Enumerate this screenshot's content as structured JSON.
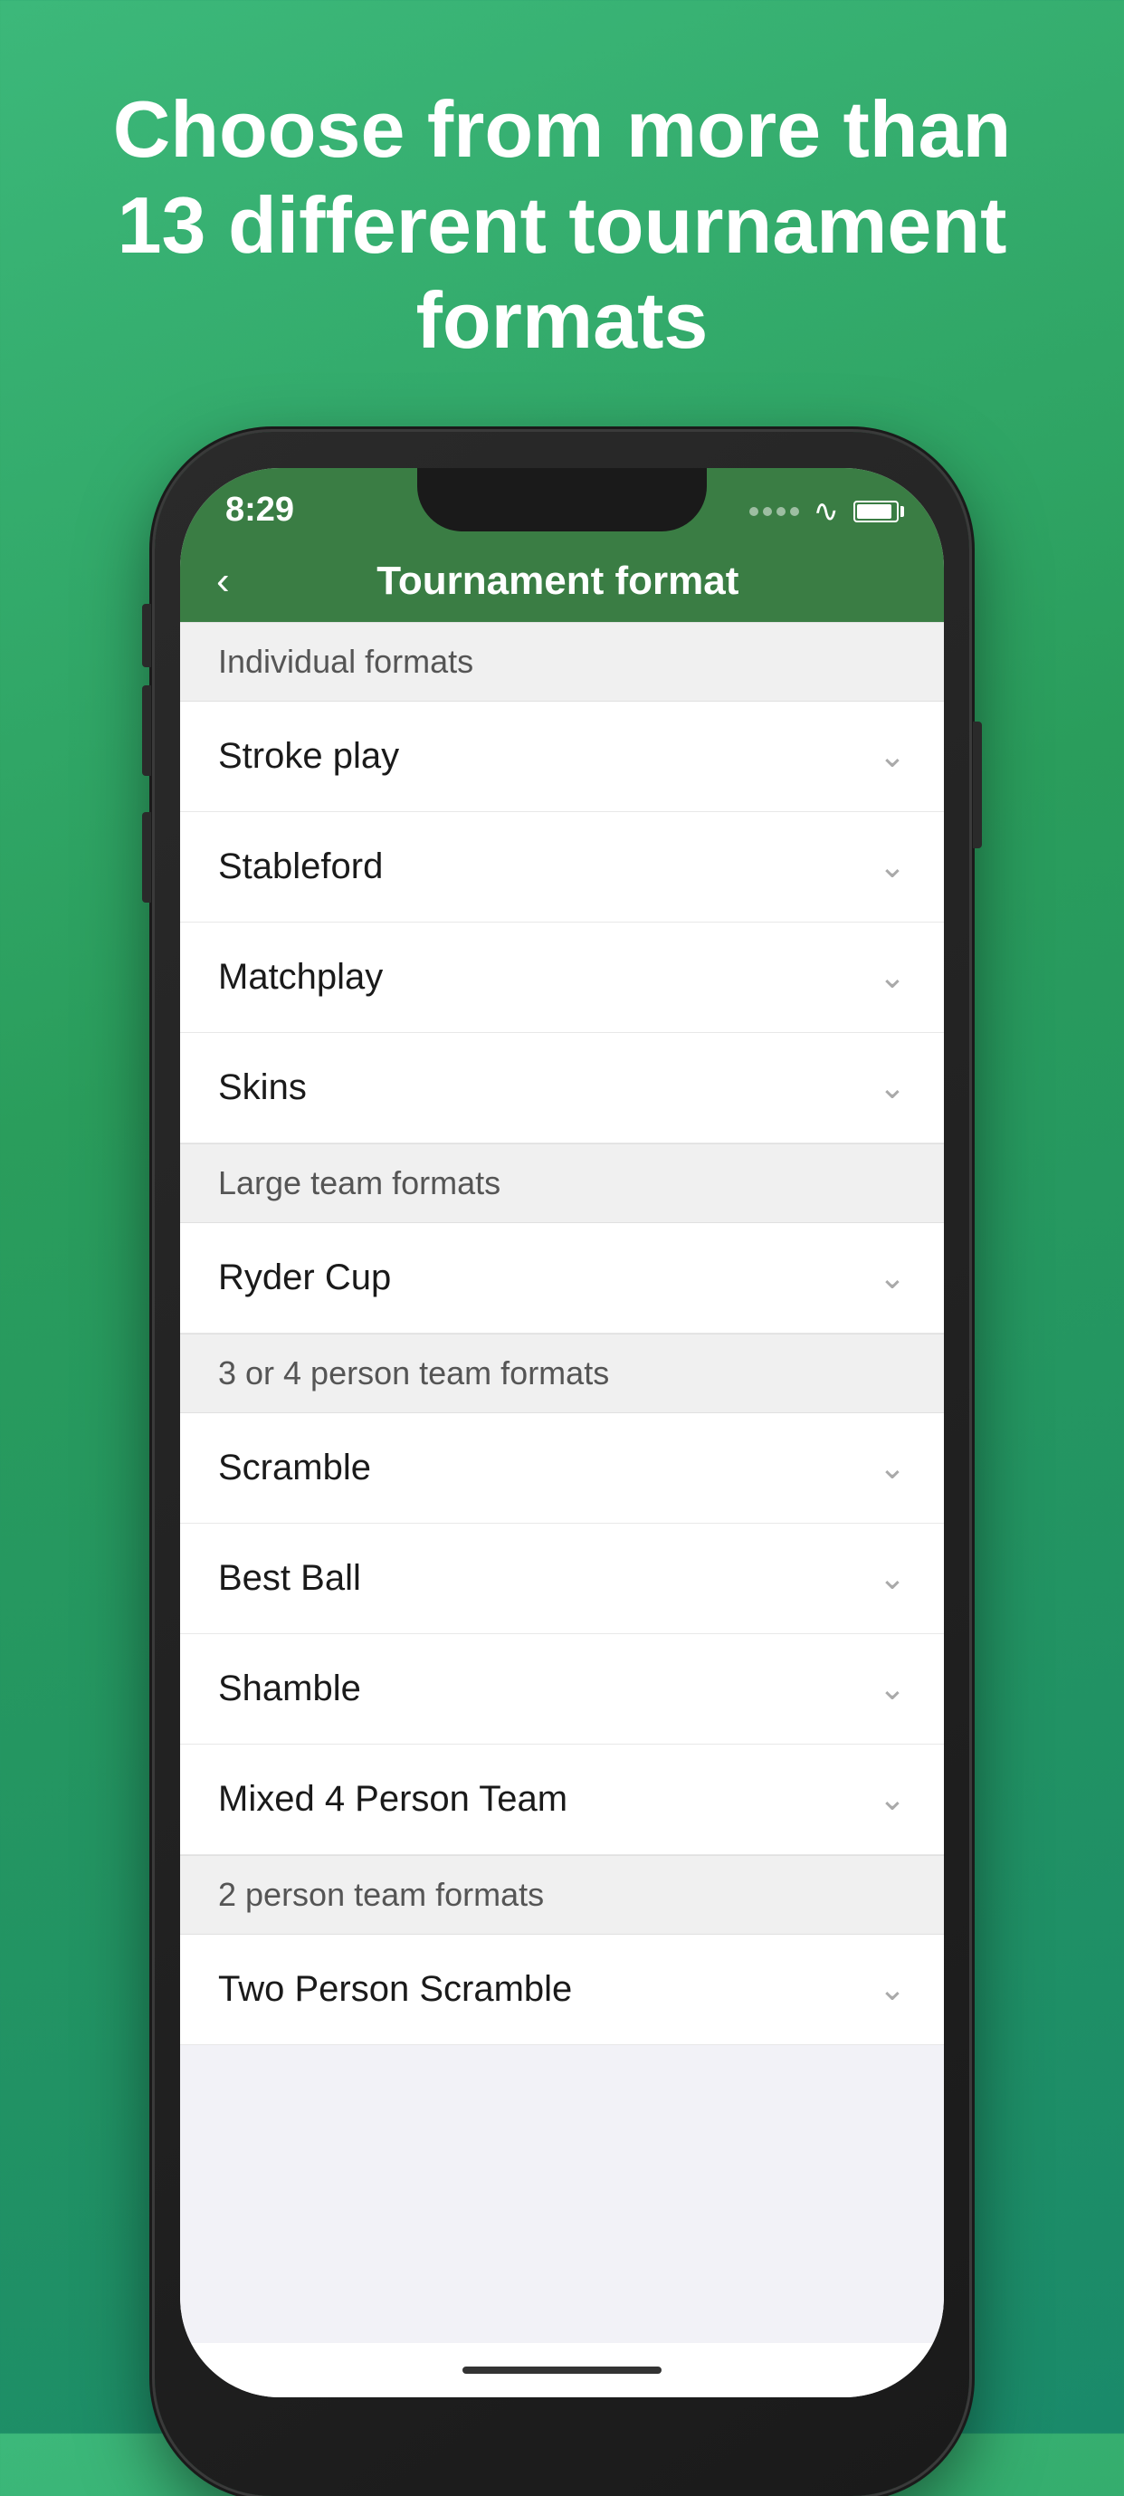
{
  "hero": {
    "title": "Choose from more than 13 different tournament formats"
  },
  "status_bar": {
    "time": "8:29"
  },
  "nav": {
    "back_label": "‹",
    "title": "Tournament format"
  },
  "sections": [
    {
      "id": "individual-formats",
      "header": "Individual formats",
      "items": [
        {
          "id": "stroke-play",
          "label": "Stroke play"
        },
        {
          "id": "stableford",
          "label": "Stableford"
        },
        {
          "id": "matchplay",
          "label": "Matchplay"
        },
        {
          "id": "skins",
          "label": "Skins"
        }
      ]
    },
    {
      "id": "large-team-formats",
      "header": "Large team formats",
      "items": [
        {
          "id": "ryder-cup",
          "label": "Ryder Cup"
        }
      ]
    },
    {
      "id": "3-or-4-person-team-formats",
      "header": "3 or 4 person team formats",
      "items": [
        {
          "id": "scramble",
          "label": "Scramble"
        },
        {
          "id": "best-ball",
          "label": "Best Ball"
        },
        {
          "id": "shamble",
          "label": "Shamble"
        },
        {
          "id": "mixed-4-person-team",
          "label": "Mixed 4 Person Team"
        }
      ]
    },
    {
      "id": "2-person-team-formats",
      "header": "2 person team formats",
      "items": [
        {
          "id": "two-person-scramble",
          "label": "Two Person Scramble"
        }
      ]
    }
  ],
  "home_indicator": {},
  "icons": {
    "chevron_down": "⌄",
    "back_arrow": "‹"
  },
  "colors": {
    "header_green": "#3a7d44",
    "background": "#f2f2f7",
    "section_bg": "#f0f0f0"
  }
}
